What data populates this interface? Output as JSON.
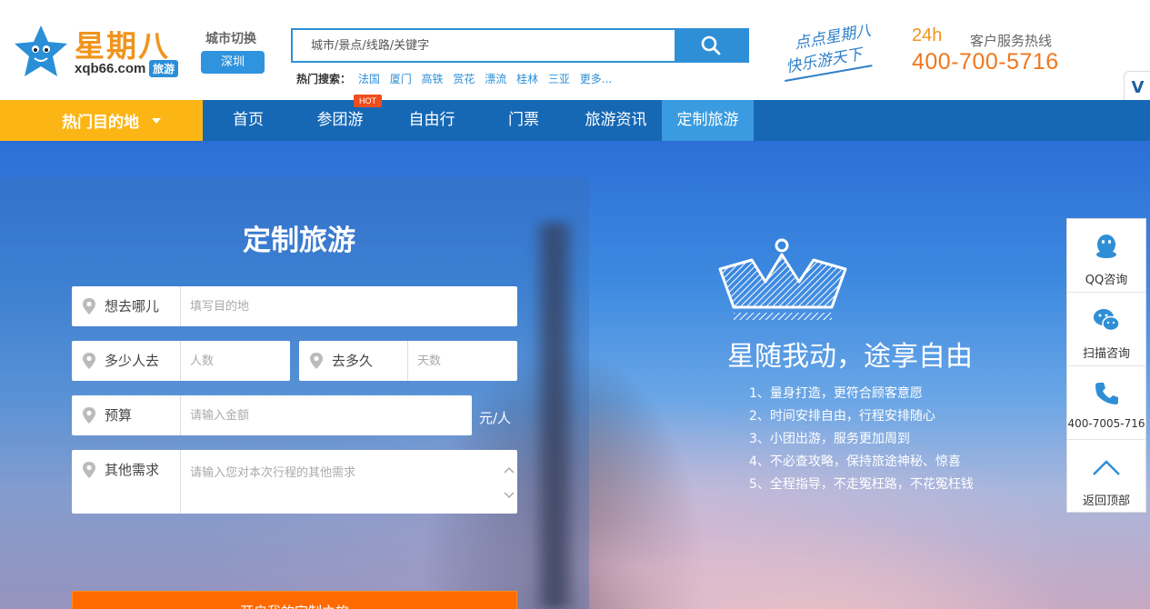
{
  "logo": {
    "brand": "星期八",
    "domain": "xqb66.com",
    "tag": "旅游"
  },
  "city": {
    "label": "城市切换",
    "current": "深圳"
  },
  "search": {
    "placeholder": "城市/景点/线路/关键字",
    "hot_label": "热门搜索：",
    "hot_terms": [
      "法国",
      "厦门",
      "高铁",
      "赏花",
      "漂流",
      "桂林",
      "三亚",
      "更多..."
    ]
  },
  "slogan": {
    "line1": "点点星期八",
    "line2": "快乐游天下"
  },
  "hotline": {
    "badge": "24h",
    "label": "客户服务热线",
    "number": "400-700-5716"
  },
  "side_tab": {
    "label": "V"
  },
  "nav": {
    "hot_destinations": "热门目的地",
    "items": [
      "首页",
      "参团游",
      "自由行",
      "门票",
      "旅游资讯",
      "定制旅游"
    ],
    "hot_badge": "HOT",
    "active": "定制旅游"
  },
  "form": {
    "title": "定制旅游",
    "destination": {
      "label": "想去哪儿",
      "placeholder": "填写目的地"
    },
    "people": {
      "label": "多少人去",
      "placeholder": "人数"
    },
    "duration": {
      "label": "去多久",
      "placeholder": "天数"
    },
    "budget": {
      "label": "预算",
      "placeholder": "请输入金额",
      "unit": "元/人"
    },
    "other": {
      "label": "其他需求",
      "placeholder": "请输入您对本次行程的其他需求"
    },
    "submit": "开启我的定制之旅"
  },
  "hero": {
    "tagline": "星随我动，途享自由",
    "features": [
      "1、量身打造，更符合顾客意愿",
      "2、时间安排自由，行程安排随心",
      "3、小团出游，服务更加周到",
      "4、不必查攻略，保持旅途神秘、惊喜",
      "5、全程指导，不走冤枉路，不花冤枉钱"
    ]
  },
  "side_widget": {
    "qq": "QQ咨询",
    "scan": "扫描咨询",
    "phone": "400-7005-716",
    "top": "返回顶部"
  },
  "colors": {
    "brand_blue": "#1668b5",
    "accent_orange": "#ff6a00",
    "hot_yellow": "#fbb615",
    "active_blue": "#3a9be0"
  }
}
